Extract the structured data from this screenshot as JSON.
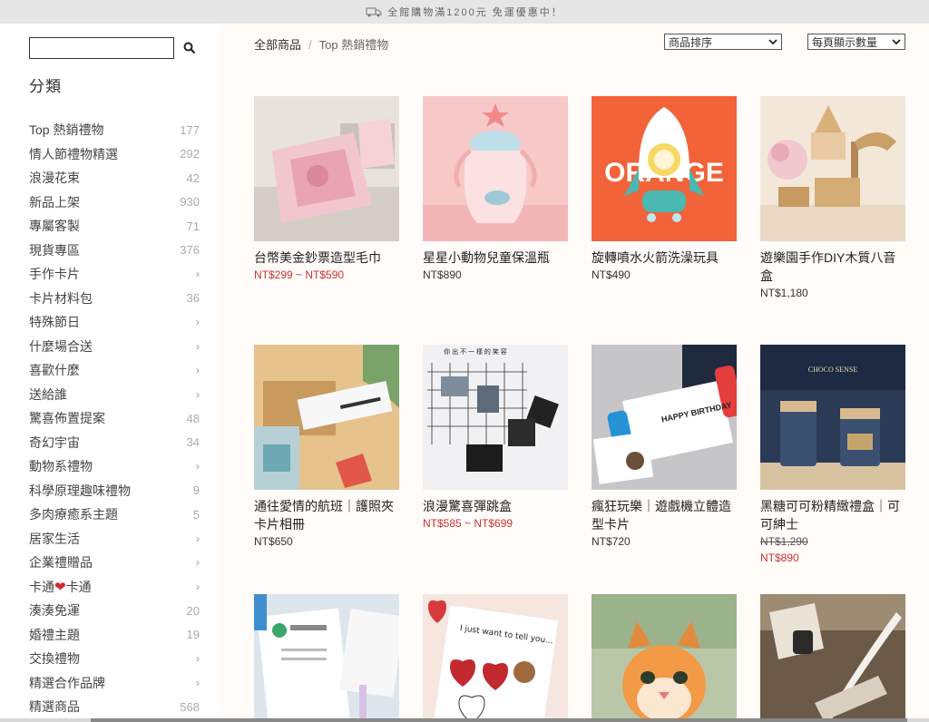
{
  "announcement": "全館購物滿1200元 免運優惠中！",
  "sidebar": {
    "search_placeholder": "",
    "category_title": "分類",
    "categories": [
      {
        "label": "Top 熱銷禮物",
        "count": "177"
      },
      {
        "label": "情人節禮物精選",
        "count": "292"
      },
      {
        "label": "浪漫花束",
        "count": "42"
      },
      {
        "label": "新品上架",
        "count": "930"
      },
      {
        "label": "專屬客製",
        "count": "71"
      },
      {
        "label": "現貨專區",
        "count": "376"
      },
      {
        "label": "手作卡片",
        "count": ""
      },
      {
        "label": "卡片材料包",
        "count": "36"
      },
      {
        "label": "特殊節日",
        "count": ""
      },
      {
        "label": "什麼場合送",
        "count": ""
      },
      {
        "label": "喜歡什麼",
        "count": ""
      },
      {
        "label": "送給誰",
        "count": ""
      },
      {
        "label": "驚喜佈置提案",
        "count": "48"
      },
      {
        "label": "奇幻宇宙",
        "count": "34"
      },
      {
        "label": "動物系禮物",
        "count": ""
      },
      {
        "label": "科學原理趣味禮物",
        "count": "9"
      },
      {
        "label": "多肉療癒系主題",
        "count": "5"
      },
      {
        "label": "居家生活",
        "count": ""
      },
      {
        "label": "企業禮贈品",
        "count": ""
      },
      {
        "label": "卡通",
        "label_b": "卡通",
        "count": ""
      },
      {
        "label": "湊湊免運",
        "count": "20"
      },
      {
        "label": "婚禮主題",
        "count": "19"
      },
      {
        "label": "交換禮物",
        "count": ""
      },
      {
        "label": "精選合作品牌",
        "count": ""
      },
      {
        "label": "精選商品",
        "count": "568"
      }
    ]
  },
  "breadcrumb": {
    "root": "全部商品",
    "current": "Top 熱銷禮物"
  },
  "sort_select": {
    "value": "商品排序"
  },
  "perpage_select": {
    "value": "每頁顯示數量"
  },
  "products": [
    {
      "name": "台幣美金鈔票造型毛巾",
      "price": "NT$299 ~ NT$590",
      "price_style": "sale"
    },
    {
      "name": "星星小動物兒童保溫瓶",
      "price": "NT$890",
      "price_style": "normal"
    },
    {
      "name": "旋轉噴水火箭洗澡玩具",
      "price": "NT$490",
      "price_style": "normal",
      "image_text": "ORANGE"
    },
    {
      "name": "遊樂園手作DIY木質八音盒",
      "price": "NT$1,180",
      "price_style": "normal"
    },
    {
      "name": "通往愛情的航班｜護照夾卡片相冊",
      "price": "NT$650",
      "price_style": "normal"
    },
    {
      "name": "浪漫驚喜彈跳盒",
      "price": "NT$585 ~ NT$699",
      "price_style": "sale",
      "image_text": "你 出 不 一 樣 的 笑 容"
    },
    {
      "name": "瘋狂玩樂｜遊戲機立體造型卡片",
      "price": "NT$720",
      "price_style": "normal",
      "image_text": "HAPPY BIRTHDAY"
    },
    {
      "name": "黑糖可可粉精緻禮盒｜可可紳士",
      "price_old": "NT$1,290",
      "price": "NT$890",
      "price_style": "sale",
      "image_text": "CHOCO SENSE"
    },
    {
      "name": "",
      "price": "",
      "price_style": "normal"
    },
    {
      "name": "",
      "price": "",
      "price_style": "normal",
      "image_text": "I just want to tell you..."
    },
    {
      "name": "",
      "price": "",
      "price_style": "normal"
    },
    {
      "name": "",
      "price": "",
      "price_style": "normal"
    }
  ],
  "colors": {
    "sale_price": "#c83232",
    "main_bg": "#fffcfa",
    "topbar_bg": "#e6e6e6"
  }
}
